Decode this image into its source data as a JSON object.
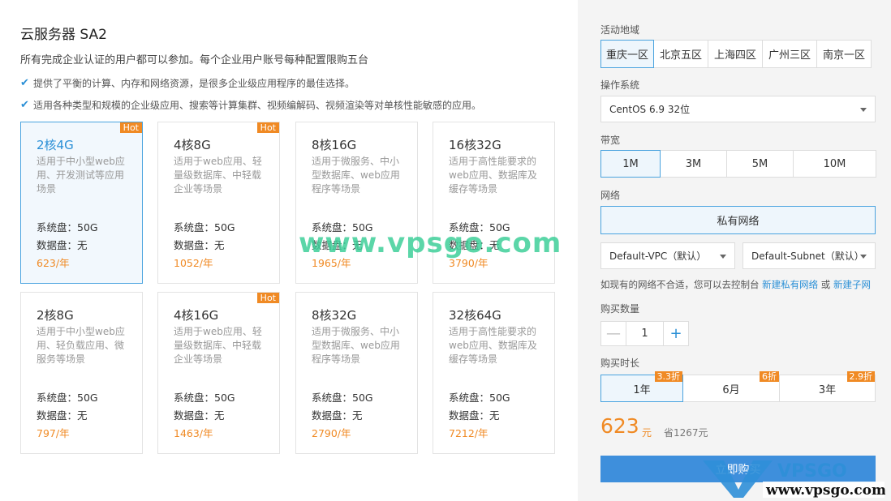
{
  "product": {
    "title": "云服务器 SA2",
    "subtitle": "所有完成企业认证的用户都可以参加。每个企业用户账号每种配置限购五台",
    "features": [
      "提供了平衡的计算、内存和网络资源，是很多企业级应用程序的最佳选择。",
      "适用各种类型和规模的企业级应用、搜索等计算集群、视频编解码、视频渲染等对单核性能敏感的应用。"
    ]
  },
  "cards": [
    {
      "spec": "2核4G",
      "hot": "Hot",
      "desc": "适用于中小型web应用、开发测试等应用场景",
      "sys": "系统盘：50G",
      "data": "数据盘：无",
      "price": "623/年",
      "selected": true
    },
    {
      "spec": "4核8G",
      "hot": "Hot",
      "desc": "适用于web应用、轻量级数据库、中轻载企业等场景",
      "sys": "系统盘：50G",
      "data": "数据盘：无",
      "price": "1052/年"
    },
    {
      "spec": "8核16G",
      "hot": "",
      "desc": "适用于微服务、中小型数据库、web应用程序等场景",
      "sys": "系统盘：50G",
      "data": "数据盘：无",
      "price": "1965/年"
    },
    {
      "spec": "16核32G",
      "hot": "",
      "desc": "适用于高性能要求的web应用、数据库及缓存等场景",
      "sys": "系统盘：50G",
      "data": "数据盘：无",
      "price": "3790/年"
    },
    {
      "spec": "2核8G",
      "hot": "",
      "desc": "适用于中小型web应用、轻负载应用、微服务等场景",
      "sys": "系统盘：50G",
      "data": "数据盘：无",
      "price": "797/年"
    },
    {
      "spec": "4核16G",
      "hot": "Hot",
      "desc": "适用于web应用、轻量级数据库、中轻载企业等场景",
      "sys": "系统盘：50G",
      "data": "数据盘：无",
      "price": "1463/年"
    },
    {
      "spec": "8核32G",
      "hot": "",
      "desc": "适用于微服务、中小型数据库、web应用程序等场景",
      "sys": "系统盘：50G",
      "data": "数据盘：无",
      "price": "2790/年"
    },
    {
      "spec": "32核64G",
      "hot": "",
      "desc": "适用于高性能要求的web应用、数据库及缓存等场景",
      "sys": "系统盘：50G",
      "data": "数据盘：无",
      "price": "7212/年"
    }
  ],
  "config": {
    "region_label": "活动地域",
    "regions": [
      "重庆一区",
      "北京五区",
      "上海四区",
      "广州三区",
      "南京一区"
    ],
    "selected_region": "重庆一区",
    "os_label": "操作系统",
    "os_value": "CentOS 6.9 32位",
    "bandwidth_label": "带宽",
    "bandwidths": [
      "1M",
      "3M",
      "5M",
      "10M"
    ],
    "network_label": "网络",
    "network_value": "私有网络",
    "vpc_value": "Default-VPC（默认）",
    "subnet_value": "Default-Subnet（默认）",
    "network_hint_prefix": "如现有的网络不合适，您可以去控制台 ",
    "network_hint_link1": "新建私有网络",
    "network_hint_or": " 或 ",
    "network_hint_link2": "新建子网",
    "qty_label": "购买数量",
    "qty_minus": "—",
    "qty_value": "1",
    "qty_plus": "+",
    "duration_label": "购买时长",
    "durations": [
      {
        "label": "1年",
        "discount": "3.3折"
      },
      {
        "label": "6月",
        "discount": "6折"
      },
      {
        "label": "3年",
        "discount": "2.9折"
      }
    ],
    "price": "623",
    "price_unit": "元",
    "saving": "省1267元",
    "buy_label": "立即购买"
  },
  "watermark": {
    "text": "www.vpsgo.com",
    "logo_text": "VPSGO",
    "logo_url_text": "www.vpsgo.com"
  },
  "colors": {
    "accent": "#2a8fd6",
    "selected_border": "#4aa3df",
    "orange": "#f08a24",
    "buy_button": "#3e8fdc",
    "watermark_green": "#3fcf9a"
  }
}
